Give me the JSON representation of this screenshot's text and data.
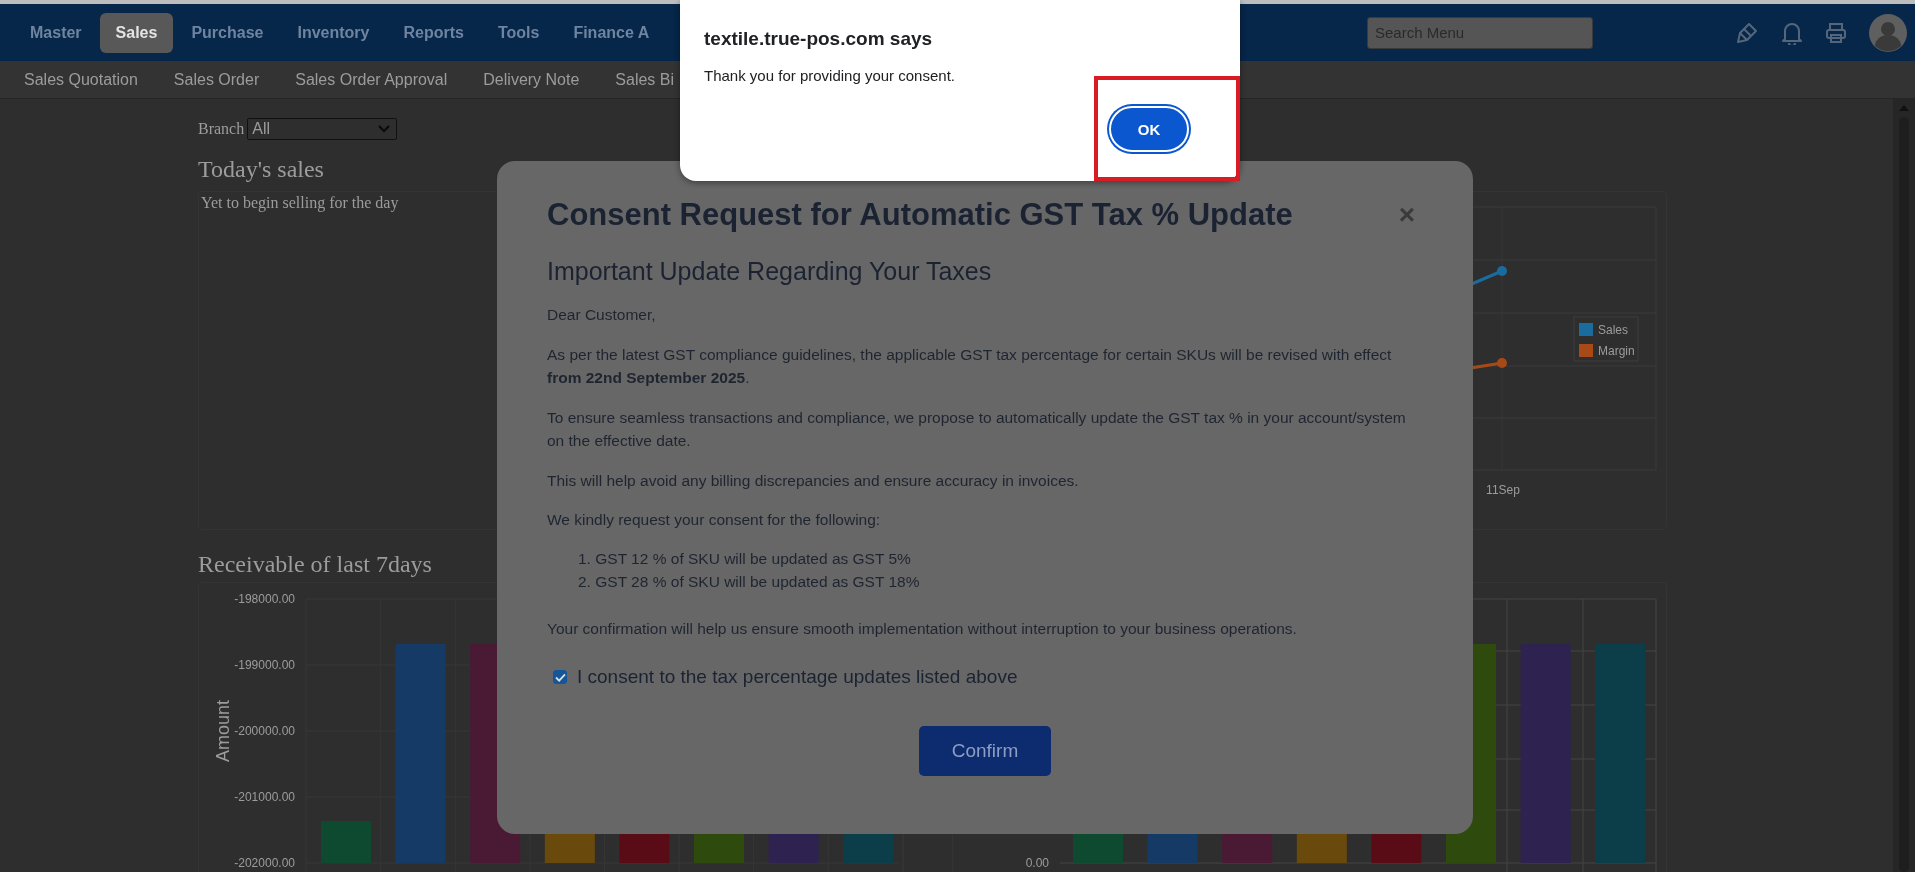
{
  "nav": {
    "items": [
      {
        "label": "Master",
        "selected": false
      },
      {
        "label": "Sales",
        "selected": true
      },
      {
        "label": "Purchase",
        "selected": false
      },
      {
        "label": "Inventory",
        "selected": false
      },
      {
        "label": "Reports",
        "selected": false
      },
      {
        "label": "Tools",
        "selected": false
      },
      {
        "label": "Finance A",
        "selected": false
      }
    ],
    "search": {
      "placeholder": "Search Menu"
    }
  },
  "subnav": {
    "items": [
      "Sales Quotation",
      "Sales Order",
      "Sales Order Approval",
      "Delivery Note",
      "Sales Bi"
    ]
  },
  "branch": {
    "label": "Branch",
    "value": "All"
  },
  "todays_sales": {
    "title": "Today's sales",
    "message": "Yet to begin selling for the day"
  },
  "sales_margin_chart": {
    "legend": [
      {
        "name": "Sales",
        "color": "#1a6c9e"
      },
      {
        "name": "Margin",
        "color": "#a84a18"
      }
    ],
    "x_label": "11Sep"
  },
  "receivable": {
    "title": "Receivable of last 7days",
    "y_axis_title": "Amount",
    "y_tick_labels": [
      "-198000.00",
      "-199000.00",
      "-200000.00",
      "-201000.00",
      "-202000.00"
    ]
  },
  "second_bar_chart": {
    "tick_label": "0.00"
  },
  "modal": {
    "title": "Consent Request for Automatic GST Tax % Update",
    "close": "×",
    "heading": "Important Update Regarding Your Taxes",
    "body": [
      {
        "kind": "text",
        "text": "Dear Customer,"
      },
      {
        "kind": "text",
        "text": "As per the latest GST compliance guidelines, the applicable GST tax percentage for certain SKUs will be revised with effect **from 22nd September 2025**."
      },
      {
        "kind": "text",
        "text": "To ensure seamless transactions and compliance, we propose to automatically update the GST tax % in your account/system on the effective date."
      },
      {
        "kind": "text",
        "text": "This will help avoid any billing discrepancies and ensure accuracy in invoices."
      },
      {
        "kind": "text",
        "text": "We kindly request your consent for the following:"
      },
      {
        "kind": "list",
        "items": [
          "1. GST 12 % of SKU will be updated as GST 5%",
          "2. GST 28 % of SKU will be updated as GST 18%"
        ]
      },
      {
        "kind": "text",
        "text": "Your confirmation will help us ensure smooth implementation without interruption to your business operations."
      }
    ],
    "consent": {
      "label": "I consent to the tax percentage updates listed above",
      "checked": true
    },
    "confirm": "Confirm"
  },
  "alert": {
    "title": "textile.true-pos.com says",
    "message": "Thank you for providing your consent.",
    "button": "OK"
  }
}
